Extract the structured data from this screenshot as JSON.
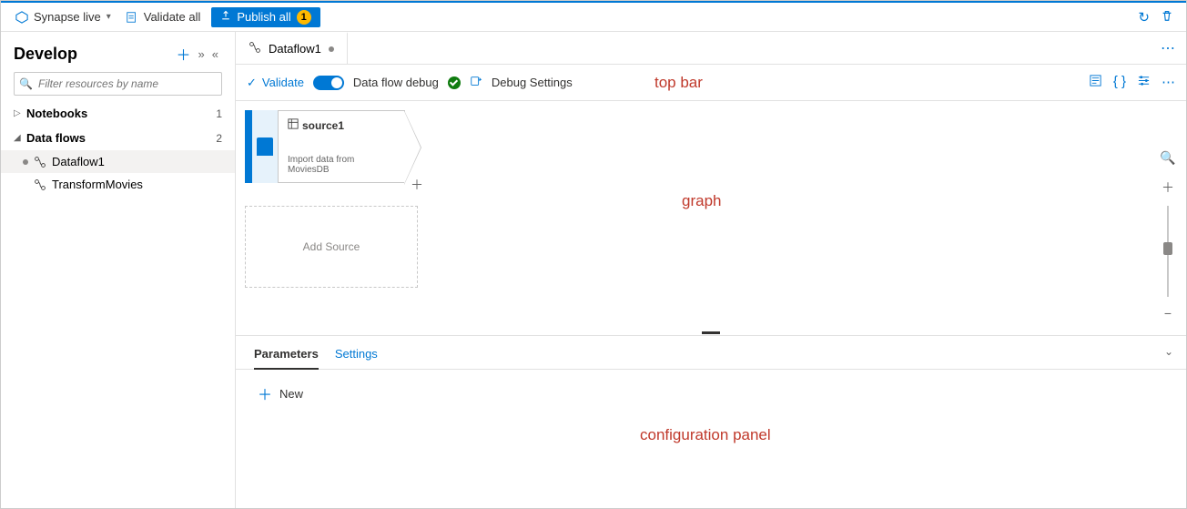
{
  "commandBar": {
    "workspace": "Synapse live",
    "validateAll": "Validate all",
    "publishAll": "Publish all",
    "publishBadge": "1"
  },
  "sidebar": {
    "title": "Develop",
    "filterPlaceholder": "Filter resources by name",
    "groups": [
      {
        "label": "Notebooks",
        "count": "1",
        "expanded": false
      },
      {
        "label": "Data flows",
        "count": "2",
        "expanded": true
      }
    ],
    "dataflowItems": [
      {
        "label": "Dataflow1",
        "unsaved": true,
        "selected": true
      },
      {
        "label": "TransformMovies",
        "unsaved": false,
        "selected": false
      }
    ]
  },
  "tab": {
    "title": "Dataflow1"
  },
  "topbar": {
    "validate": "Validate",
    "debugLabel": "Data flow debug",
    "debugSettings": "Debug Settings"
  },
  "graph": {
    "source": {
      "name": "source1",
      "desc": "Import data from MoviesDB"
    },
    "addSource": "Add Source"
  },
  "config": {
    "tabs": {
      "parameters": "Parameters",
      "settings": "Settings"
    },
    "newBtn": "New"
  },
  "annotations": {
    "topbar": "top bar",
    "graph": "graph",
    "config": "configuration panel"
  }
}
